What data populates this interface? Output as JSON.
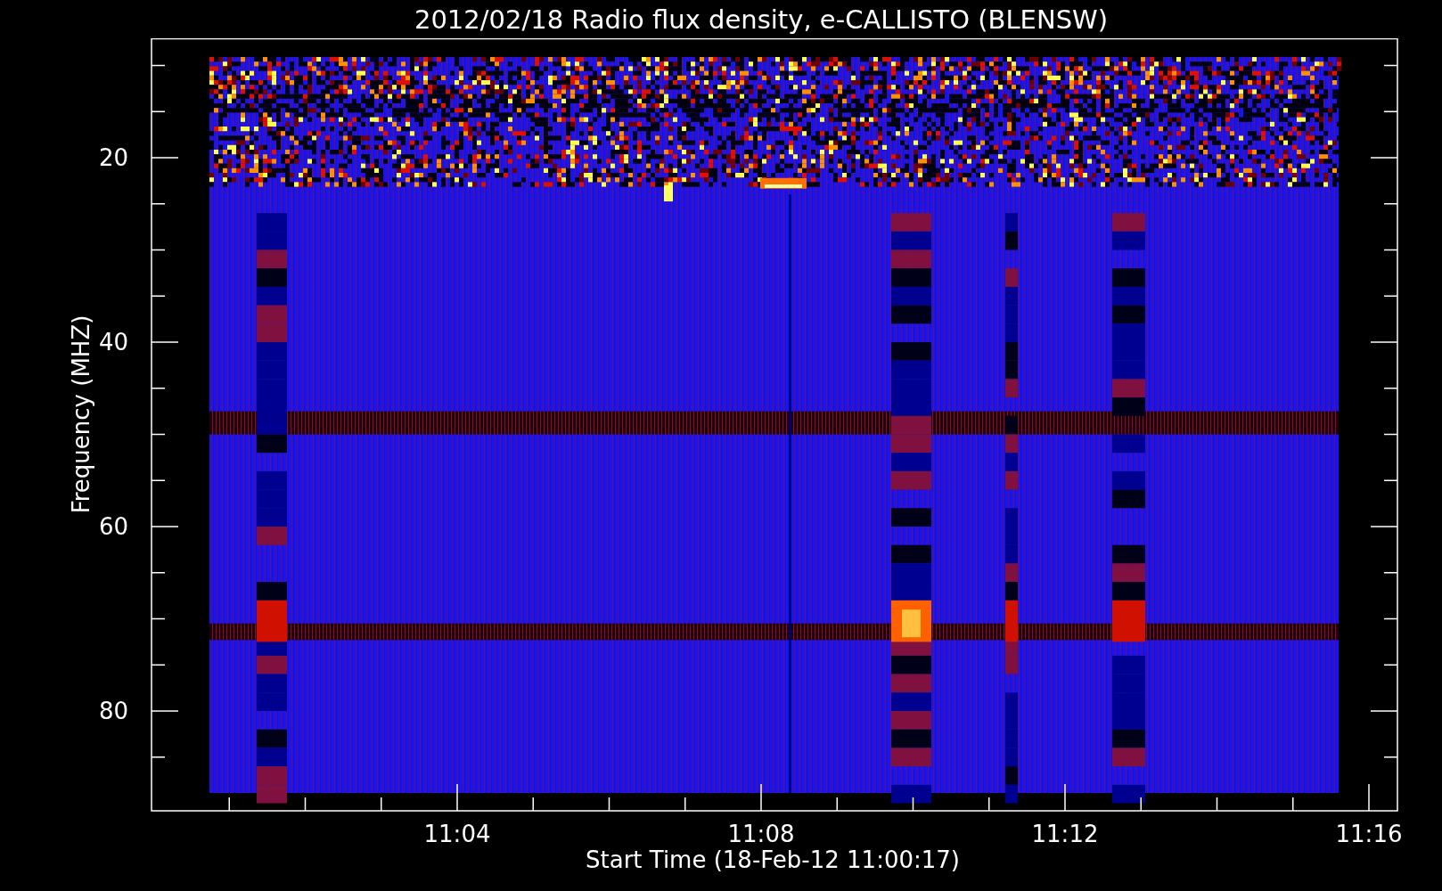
{
  "title": "2012/02/18  Radio flux density, e-CALLISTO (BLENSW)",
  "plot": {
    "ylabel": "Frequency (MHZ)",
    "xlabel": "Start Time (18-Feb-12 11:00:17)",
    "yticks": [
      "20",
      "40",
      "60",
      "80"
    ],
    "xticks": [
      "11:04",
      "11:08",
      "11:12",
      "11:16"
    ]
  }
}
